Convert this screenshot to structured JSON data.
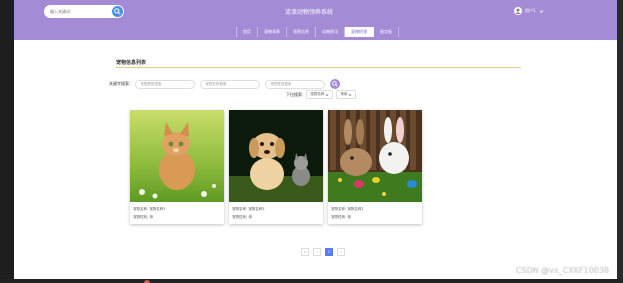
{
  "header": {
    "search_placeholder": "输入关键词",
    "title": "流浪动物领养系统",
    "user_name": "用户1"
  },
  "nav": {
    "items": [
      "首页",
      "宠物领养",
      "领养信息",
      "动物资讯",
      "宠物招领",
      "留言板"
    ],
    "active_index": 4
  },
  "section": {
    "title": "宠物信息列表"
  },
  "filters": {
    "label": "关键字搜索:",
    "field1_placeholder": "宠物类型搜索",
    "field2_placeholder": "宠物名称搜索",
    "field3_placeholder": "宠物性别搜索"
  },
  "sort": {
    "label": "下拉搜索:",
    "option1": "宠物名称",
    "option2": "排序"
  },
  "cards": [
    {
      "name_label": "宠物名称:",
      "name": "宠物名称1",
      "gender_label": "宠物性别:",
      "gender": "母"
    },
    {
      "name_label": "宠物名称:",
      "name": "宠物名称3",
      "gender_label": "宠物性别:",
      "gender": "母"
    },
    {
      "name_label": "宠物名称:",
      "name": "宠物名称2",
      "gender_label": "宠物性别:",
      "gender": "母"
    }
  ],
  "pagination": {
    "prev": "«",
    "prev2": "‹",
    "current": "1",
    "next": "›"
  },
  "watermark": "CSDN @vx_CXKF10038",
  "colors": {
    "topbar": "#a48bd6",
    "accent_search": "#4a90e2",
    "page_active": "#5b7bf5",
    "divider": "#e9c98b"
  }
}
